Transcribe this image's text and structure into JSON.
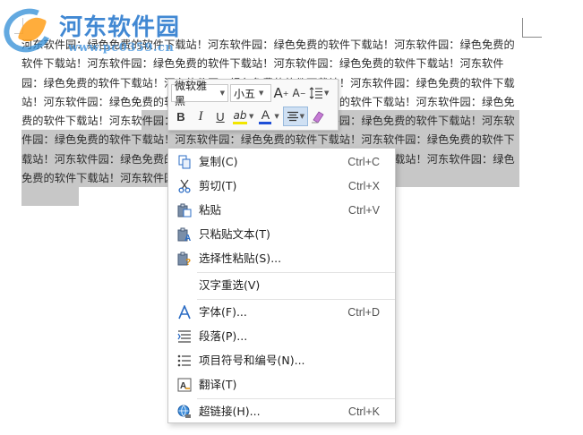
{
  "document": {
    "paragraph": "河东软件园：绿色免费的软件下载站！河东软件园：绿色免费的软件下载站！河东软件园：绿色免费的软件下载站！河东软件园：绿色免费的软件下载站！河东软件园：绿色免费的软件下载站！河东软件园：绿色免费的软件下载站！河东软件园：绿色免费的软件下载站！河东软件园：绿色免费的软件下载站！河东软件园：绿色免费的软件下载站！河东软件园：绿色免费的软件下载站！河东软件园：绿色免费的软件下载站！河东软件园：绿色免费的软件下载站！河东软件园：绿色免费的软件下载站！河东软件园：绿色免费的软件下载站！河东软件园：绿色免费的软件下载站！河东软件园：绿色免费的软件下载站！河东软件园：绿色免费的软件下载站！河东软件园：绿色免费的软件下载站！河东软件园：绿色免费的软件下载站！河东软件园：绿色免费的软件下载站！"
  },
  "watermark": {
    "title": "河东软件园",
    "url": "www.pc0359.cn"
  },
  "mini_toolbar": {
    "font_name": "微软雅黑",
    "font_size": "小五",
    "grow_font": "A",
    "shrink_font": "A",
    "bold": "B",
    "italic": "I",
    "underline": "U",
    "font_color": "A",
    "highlight": "ab"
  },
  "context_menu": {
    "items": [
      {
        "label": "复制(C)",
        "shortcut": "Ctrl+C",
        "icon": "copy-icon"
      },
      {
        "label": "剪切(T)",
        "shortcut": "Ctrl+X",
        "icon": "scissors-icon"
      },
      {
        "label": "粘贴",
        "shortcut": "Ctrl+V",
        "icon": "paste-icon"
      },
      {
        "label": "只粘贴文本(T)",
        "shortcut": "",
        "icon": "paste-text-icon"
      },
      {
        "label": "选择性粘贴(S)...",
        "shortcut": "",
        "icon": "paste-special-icon"
      },
      {
        "label": "汉字重选(V)",
        "shortcut": "",
        "icon": ""
      },
      {
        "label": "字体(F)...",
        "shortcut": "Ctrl+D",
        "icon": "font-icon"
      },
      {
        "label": "段落(P)...",
        "shortcut": "",
        "icon": "paragraph-icon"
      },
      {
        "label": "项目符号和编号(N)...",
        "shortcut": "",
        "icon": "bullet-list-icon"
      },
      {
        "label": "翻译(T)",
        "shortcut": "",
        "icon": "translate-icon"
      },
      {
        "label": "超链接(H)...",
        "shortcut": "Ctrl+K",
        "icon": "hyperlink-icon"
      }
    ]
  },
  "colors": {
    "selection": "#c7c7c7",
    "font_color_bar": "#1f4fd6",
    "highlight_bar": "#f2e600",
    "icon_blue": "#2b6cc4"
  }
}
